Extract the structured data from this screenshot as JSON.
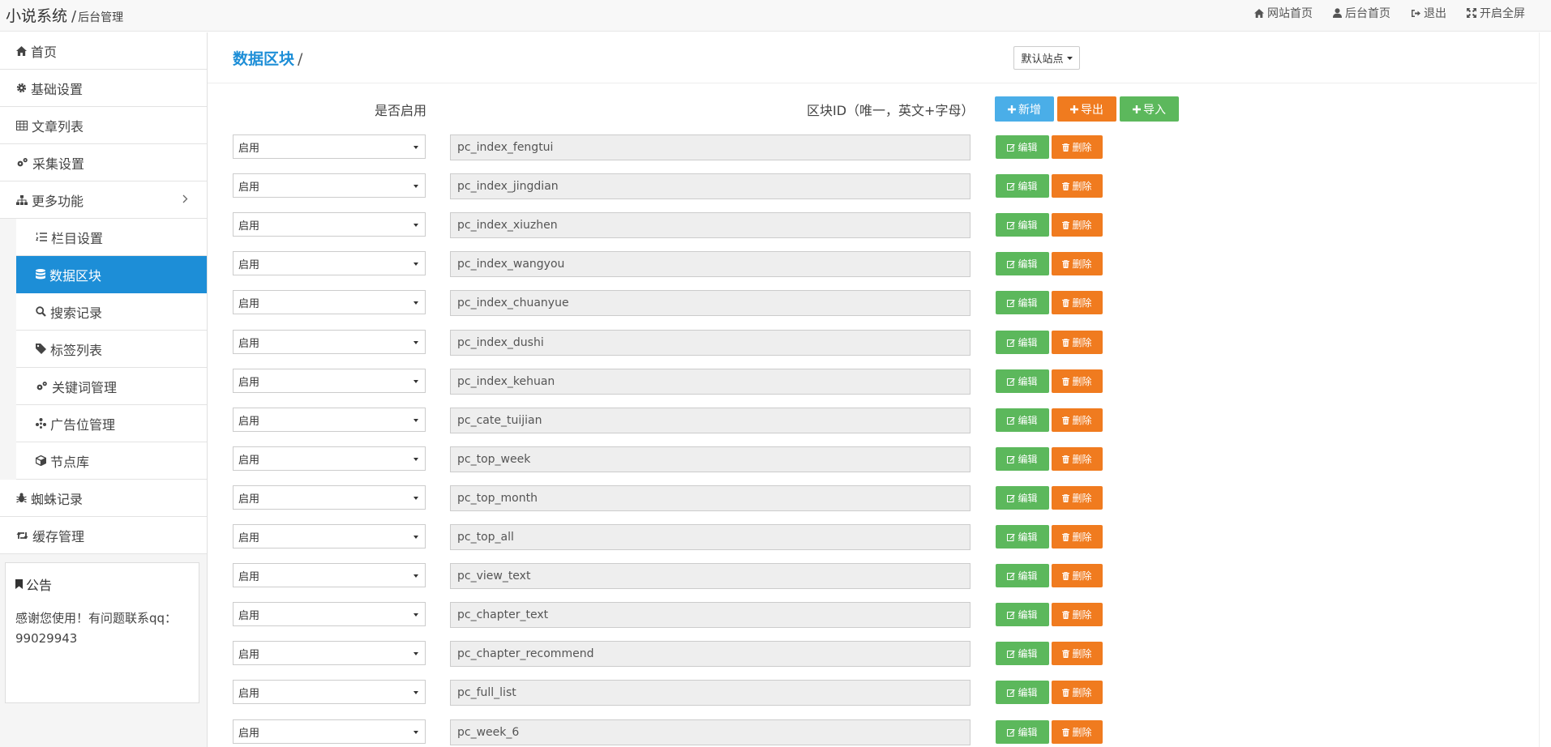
{
  "header": {
    "brand": "小说系统",
    "separator": "/",
    "subtitle": "后台管理",
    "nav": [
      {
        "label": "网站首页",
        "icon": "home-icon"
      },
      {
        "label": "后台首页",
        "icon": "user-icon"
      },
      {
        "label": "退出",
        "icon": "sign-out-icon"
      },
      {
        "label": "开启全屏",
        "icon": "fullscreen-icon"
      }
    ]
  },
  "sidebar": {
    "items": [
      {
        "label": "首页",
        "icon": "home-icon"
      },
      {
        "label": "基础设置",
        "icon": "gear-icon"
      },
      {
        "label": "文章列表",
        "icon": "table-icon"
      },
      {
        "label": "采集设置",
        "icon": "gears-icon"
      },
      {
        "label": "更多功能",
        "icon": "sitemap-icon"
      }
    ],
    "subitems": [
      {
        "label": "栏目设置",
        "icon": "list-ol-icon"
      },
      {
        "label": "数据区块",
        "icon": "database-icon"
      },
      {
        "label": "搜索记录",
        "icon": "search-icon"
      },
      {
        "label": "标签列表",
        "icon": "tag-icon"
      },
      {
        "label": "关键词管理",
        "icon": "gears-icon"
      },
      {
        "label": "广告位管理",
        "icon": "asterisk-icon"
      },
      {
        "label": "节点库",
        "icon": "cube-icon"
      }
    ],
    "bottom_items": [
      {
        "label": "蜘蛛记录",
        "icon": "bug-icon"
      },
      {
        "label": "缓存管理",
        "icon": "retweet-icon"
      }
    ],
    "notice": {
      "title": "公告",
      "text_line1": "感谢您使用！有问题联系qq：",
      "text_line2": "99029943"
    }
  },
  "main": {
    "title": "数据区块",
    "title_sep": "/",
    "site_select": "默认站点",
    "col_enabled": "是否启用",
    "col_block_id": "区块ID（唯一，英文+字母）",
    "btn_add": "新增",
    "btn_export": "导出",
    "btn_import": "导入",
    "btn_edit": "编辑",
    "btn_delete": "删除",
    "rows": [
      {
        "status": "启用",
        "id": "pc_index_fengtui"
      },
      {
        "status": "启用",
        "id": "pc_index_jingdian"
      },
      {
        "status": "启用",
        "id": "pc_index_xiuzhen"
      },
      {
        "status": "启用",
        "id": "pc_index_wangyou"
      },
      {
        "status": "启用",
        "id": "pc_index_chuanyue"
      },
      {
        "status": "启用",
        "id": "pc_index_dushi"
      },
      {
        "status": "启用",
        "id": "pc_index_kehuan"
      },
      {
        "status": "启用",
        "id": "pc_cate_tuijian"
      },
      {
        "status": "启用",
        "id": "pc_top_week"
      },
      {
        "status": "启用",
        "id": "pc_top_month"
      },
      {
        "status": "启用",
        "id": "pc_top_all"
      },
      {
        "status": "启用",
        "id": "pc_view_text"
      },
      {
        "status": "启用",
        "id": "pc_chapter_text"
      },
      {
        "status": "启用",
        "id": "pc_chapter_recommend"
      },
      {
        "status": "启用",
        "id": "pc_full_list"
      },
      {
        "status": "启用",
        "id": "pc_week_6"
      }
    ]
  },
  "colors": {
    "accent": "#1d8ed7",
    "green": "#5cb85c",
    "orange": "#f07b1f",
    "blue_button": "#4aaee8"
  }
}
